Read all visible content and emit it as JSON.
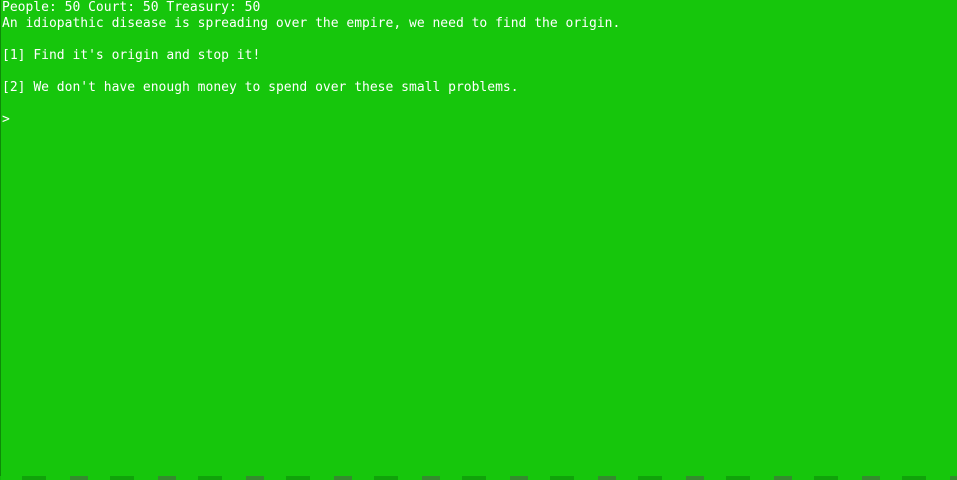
{
  "stats": {
    "people_label": "People:",
    "people_value": "50",
    "court_label": "Court:",
    "court_value": "50",
    "treasury_label": "Treasury:",
    "treasury_value": "50"
  },
  "event": {
    "message": "An idiopathic disease is spreading over the empire, we need to find the origin."
  },
  "options": [
    {
      "key": "[1]",
      "text": "Find it's origin and stop it!"
    },
    {
      "key": "[2]",
      "text": "We don't have enough money to spend over these small problems."
    }
  ],
  "prompt": {
    "symbol": ">",
    "value": ""
  },
  "colors": {
    "background": "#16c60c",
    "text": "#ffffff"
  }
}
